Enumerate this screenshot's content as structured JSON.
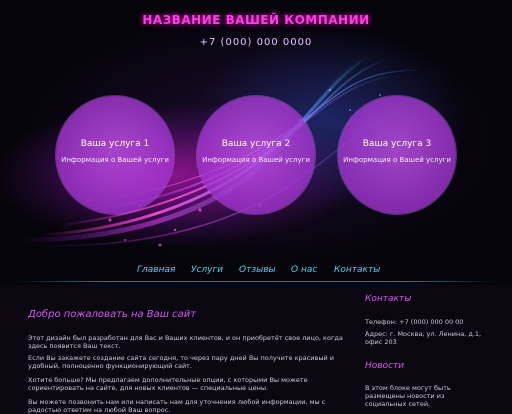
{
  "header": {
    "company_name": "НАЗВАНИЕ ВАШЕЙ КОМПАНИИ",
    "phone": "+7 (000) 000 0000"
  },
  "services": [
    {
      "title": "Ваша услуга 1",
      "subtitle": "Информация о Вашей услуги"
    },
    {
      "title": "Ваша услуга 2",
      "subtitle": "Информация о Вашей услуги"
    },
    {
      "title": "Ваша услуга 3",
      "subtitle": "Информация о Вашей услуги"
    }
  ],
  "nav": {
    "items": [
      "Главная",
      "Услуги",
      "Отзывы",
      "О нас",
      "Контакты"
    ]
  },
  "main": {
    "title": "Добро пожаловать на Ваш сайт",
    "paragraphs": [
      "Этот дизайн был разработан для Вас и Ваших клиентов, и он приобретёт свое лицо, когда здесь появится Ваш текст.",
      "Если Вы закажете создание сайта сегодня, то через пару дней Вы получите красивый и удобный, полноценно функционирующий сайт.",
      "Хотите больше? Мы предлагаем дополнительные опции, с которыми Вы можете сориентировать на сайте, для новых клиентов — специальные цены.",
      "Вы можете позвонить нам или написать нам для уточнения любой информации, мы с радостью ответим на любой Ваш вопрос."
    ]
  },
  "sidebar": {
    "contacts_title": "Контакты",
    "contacts_phone": "Телефон: +7 (000) 000 00 00",
    "contacts_address": "Адрес: г. Москва, ул. Ленина, д.1, офис 203",
    "news_title": "Новости",
    "news_text": "В этом блоке могут быть размещены новости из социальных сетей."
  },
  "colors": {
    "accent": "#d05cf0",
    "title_glow": "#ff3ee8",
    "nav_link": "#4fd0f0",
    "circle": "#b450e6"
  }
}
